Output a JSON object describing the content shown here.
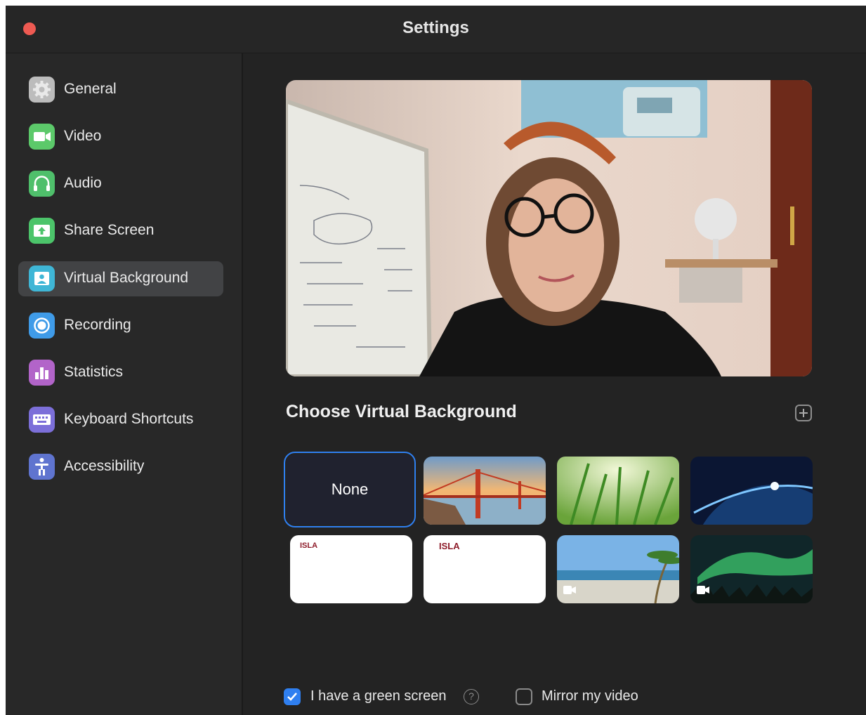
{
  "window": {
    "title": "Settings"
  },
  "sidebar": {
    "items": [
      {
        "label": "General",
        "icon": "gear-icon",
        "color": "#bcbcbc",
        "active": false
      },
      {
        "label": "Video",
        "icon": "video-camera-icon",
        "color": "#5cc96a",
        "active": false
      },
      {
        "label": "Audio",
        "icon": "headphones-icon",
        "color": "#4fbf6b",
        "active": false
      },
      {
        "label": "Share Screen",
        "icon": "share-screen-icon",
        "color": "#4cc46a",
        "active": false
      },
      {
        "label": "Virtual Background",
        "icon": "virtual-background-icon",
        "color": "#3fb6d6",
        "active": true
      },
      {
        "label": "Recording",
        "icon": "record-icon",
        "color": "#3f9be8",
        "active": false
      },
      {
        "label": "Statistics",
        "icon": "bar-chart-icon",
        "color": "#b264c9",
        "active": false
      },
      {
        "label": "Keyboard Shortcuts",
        "icon": "keyboard-icon",
        "color": "#7c6fd9",
        "active": false
      },
      {
        "label": "Accessibility",
        "icon": "accessibility-icon",
        "color": "#5f74cf",
        "active": false
      }
    ]
  },
  "main": {
    "section_title": "Choose Virtual Background",
    "backgrounds": [
      {
        "label": "None",
        "type": "none",
        "selected": true
      },
      {
        "type": "golden-gate-bridge"
      },
      {
        "type": "grass"
      },
      {
        "type": "earth-from-space"
      },
      {
        "type": "isla-logo",
        "logo_text": "ISLA"
      },
      {
        "type": "isla-logo",
        "logo_text": "ISLA"
      },
      {
        "type": "beach-video"
      },
      {
        "type": "aurora-video"
      }
    ],
    "green_screen": {
      "label": "I have a green screen",
      "checked": true
    },
    "mirror_video": {
      "label": "Mirror my video",
      "checked": false
    },
    "help_symbol": "?"
  },
  "colors": {
    "accent": "#2f7ff0",
    "background": "#232323",
    "sidebar": "#282828",
    "active_item": "#424345"
  }
}
